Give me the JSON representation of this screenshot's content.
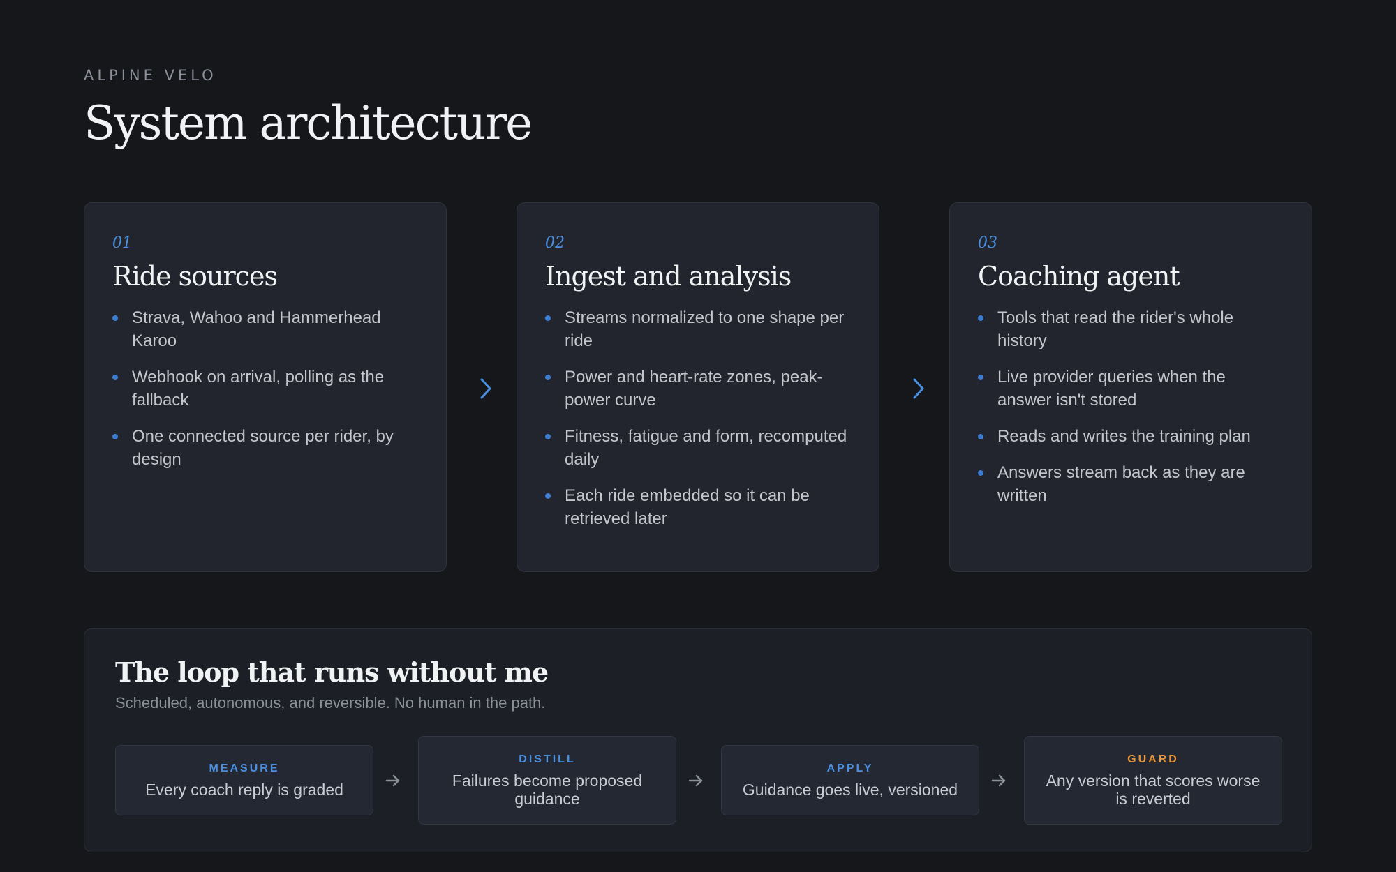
{
  "header": {
    "eyebrow": "ALPINE VELO",
    "title": "System architecture"
  },
  "colors": {
    "background": "#15171b",
    "accent_blue": "#4a90e2",
    "accent_orange": "#e8953a"
  },
  "stages": [
    {
      "number": "01",
      "title": "Ride sources",
      "items": [
        "Strava, Wahoo and Hammerhead Karoo",
        "Webhook on arrival, polling as the fallback",
        "One connected source per rider, by design"
      ]
    },
    {
      "number": "02",
      "title": "Ingest and analysis",
      "items": [
        "Streams normalized to one shape per ride",
        "Power and heart-rate zones, peak-power curve",
        "Fitness, fatigue and form, recomputed daily",
        "Each ride embedded so it can be retrieved later"
      ]
    },
    {
      "number": "03",
      "title": "Coaching agent",
      "items": [
        "Tools that read the rider's whole history",
        "Live provider queries when the answer isn't stored",
        "Reads and writes the training plan",
        "Answers stream back as they are written"
      ]
    }
  ],
  "loop": {
    "title": "The loop that runs without me",
    "subtitle": "Scheduled, autonomous, and reversible. No human in the path.",
    "steps": [
      {
        "label": "MEASURE",
        "text": "Every coach reply is graded",
        "color": "#4a90e2"
      },
      {
        "label": "DISTILL",
        "text": "Failures become proposed guidance",
        "color": "#4a90e2"
      },
      {
        "label": "APPLY",
        "text": "Guidance goes live, versioned",
        "color": "#4a90e2"
      },
      {
        "label": "GUARD",
        "text": "Any version that scores worse is reverted",
        "color": "#e8953a"
      }
    ]
  }
}
